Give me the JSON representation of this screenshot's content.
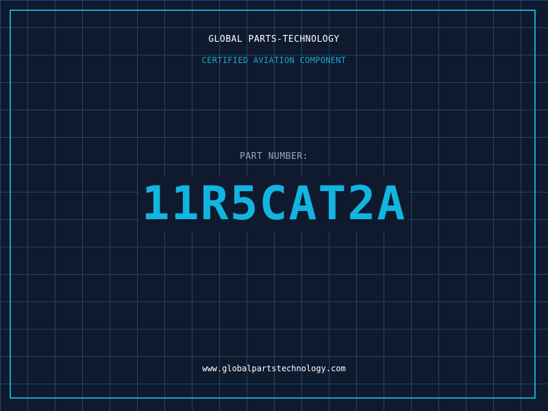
{
  "header": {
    "company": "GLOBAL PARTS-TECHNOLOGY",
    "tagline": "CERTIFIED AVIATION COMPONENT"
  },
  "part": {
    "label": "PART NUMBER:",
    "number": "11R5CAT2A"
  },
  "footer": {
    "url": "www.globalpartstechnology.com"
  },
  "colors": {
    "background": "#0f1a2e",
    "grid": "#1d4a63",
    "frame": "#1aa6cc",
    "accent": "#12b5e0",
    "label": "#9aa6b8",
    "text": "#ffffff"
  }
}
